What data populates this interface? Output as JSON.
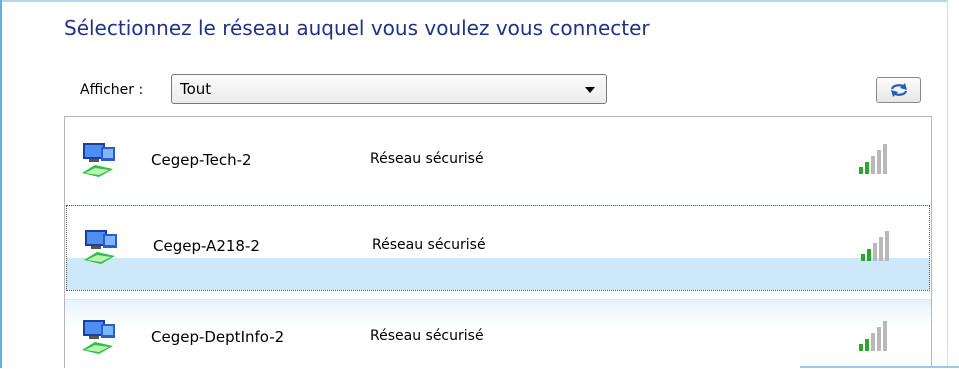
{
  "dialog": {
    "title": "Sélectionnez le réseau auquel vous voulez vous connecter"
  },
  "filter": {
    "label": "Afficher :",
    "selected": "Tout"
  },
  "toolbar": {
    "refresh_icon": "refresh-arrows-icon"
  },
  "networks": [
    {
      "name": "Cegep-Tech-2",
      "status": "Réseau sécurisé",
      "icon": "wireless-network-icon",
      "signal_bars": 2,
      "signal_max": 5
    },
    {
      "name": "Cegep-A218-2",
      "status": "Réseau sécurisé",
      "icon": "wireless-network-icon",
      "signal_bars": 2,
      "signal_max": 5
    },
    {
      "name": "Cegep-DeptInfo-2",
      "status": "Réseau sécurisé",
      "icon": "wireless-network-icon",
      "signal_bars": 2,
      "signal_max": 5
    }
  ],
  "colors": {
    "title": "#1e3287",
    "selection": "#cde8fb",
    "signal_active": "#2aa82a",
    "signal_inactive": "#b8b8b8"
  }
}
